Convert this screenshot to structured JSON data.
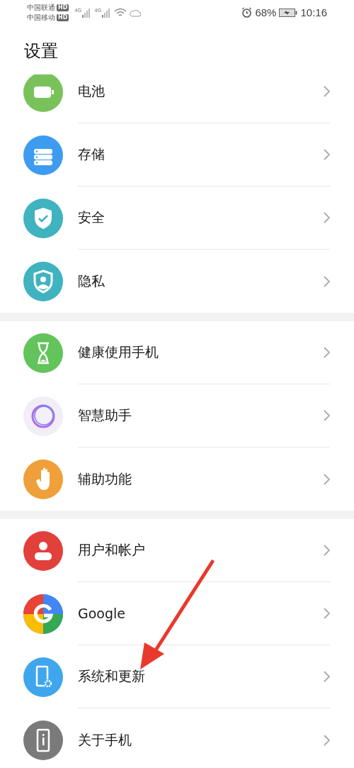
{
  "status_bar": {
    "carriers": [
      {
        "name": "中国联通",
        "badge": "HD"
      },
      {
        "name": "中国移动",
        "badge": "HD"
      }
    ],
    "signals": [
      {
        "label": "4G"
      },
      {
        "label": "4G"
      }
    ],
    "battery_percent": "68%",
    "time": "10:16"
  },
  "title": "设置",
  "groups": [
    {
      "items": [
        {
          "label": "电池",
          "kind": "battery",
          "color": "#79c25a"
        },
        {
          "label": "存储",
          "kind": "storage",
          "color": "#3d9cf0"
        },
        {
          "label": "安全",
          "kind": "shield-check",
          "color": "#3fb3bf"
        },
        {
          "label": "隐私",
          "kind": "shield-person",
          "color": "#3fb3bf"
        }
      ]
    },
    {
      "items": [
        {
          "label": "健康使用手机",
          "kind": "hourglass",
          "color": "#62c45a"
        },
        {
          "label": "智慧助手",
          "kind": "ring",
          "color": "#f1eef6"
        },
        {
          "label": "辅助功能",
          "kind": "hand",
          "color": "#f0a03a"
        }
      ]
    },
    {
      "items": [
        {
          "label": "用户和帐户",
          "kind": "person",
          "color": "#e2403a"
        },
        {
          "label": "Google",
          "kind": "google",
          "color": "#4285f4"
        },
        {
          "label": "系统和更新",
          "kind": "phone-gear",
          "color": "#3fa6ee"
        },
        {
          "label": "关于手机",
          "kind": "phone-info",
          "color": "#7a7a7a"
        }
      ]
    }
  ]
}
